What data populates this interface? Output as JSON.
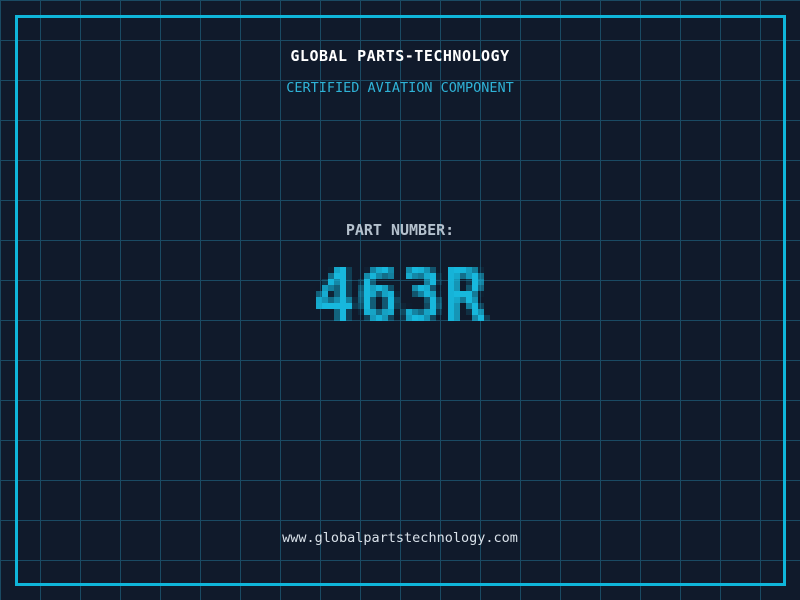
{
  "brand": {
    "title": "GLOBAL PARTS-TECHNOLOGY",
    "subtitle": "CERTIFIED AVIATION COMPONENT"
  },
  "part": {
    "label": "PART NUMBER:",
    "number": "463R"
  },
  "footer": {
    "website": "www.globalpartstechnology.com"
  },
  "colors": {
    "background": "#101a2b",
    "grid_line": "#1a4a63",
    "frame_border": "#0fb5da",
    "title_text": "#ffffff",
    "subtitle_text": "#2fb3d7",
    "part_label_text": "#b5c1cd",
    "part_number_text": "#17b8dd",
    "website_text": "#d9e1e9"
  }
}
